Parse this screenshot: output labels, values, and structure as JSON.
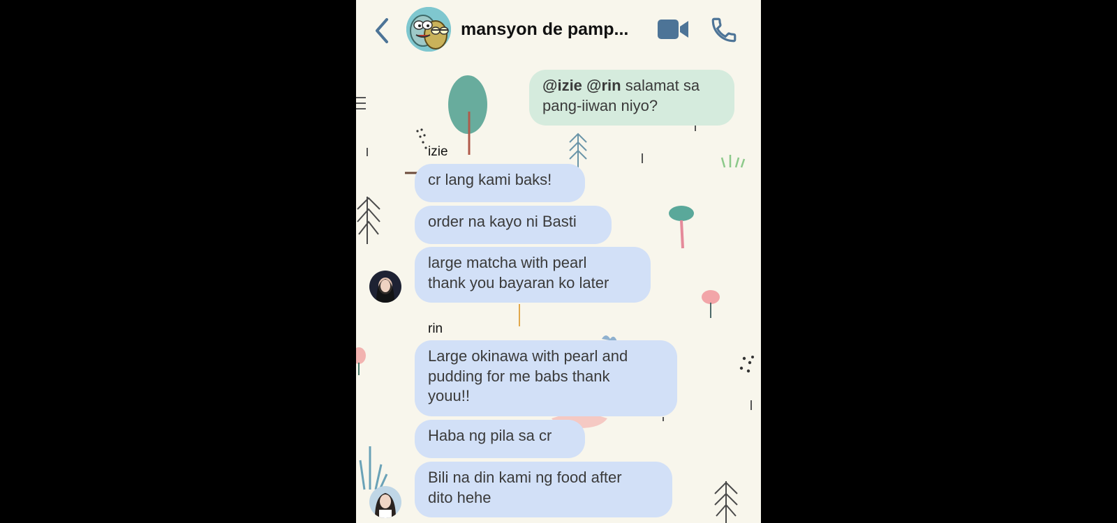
{
  "header": {
    "group_name": "mansyon de pamp...",
    "icons": {
      "back": "chevron-left-icon",
      "video": "video-camera-icon",
      "call": "phone-icon"
    },
    "accent_color": "#4d7497"
  },
  "messages": {
    "outgoing": {
      "mention_1": "@izie",
      "mention_2": "@rin",
      "text_1": " salamat sa",
      "text_2": "pang-iiwan niyo?"
    },
    "izie": {
      "sender": "izie",
      "m1": "cr lang kami baks!",
      "m2": "order na kayo ni Basti",
      "m3_l1": "large matcha with pearl",
      "m3_l2": "thank you bayaran ko later"
    },
    "rin": {
      "sender": "rin",
      "m1_l1": "Large okinawa with pearl and",
      "m1_l2": "pudding for me babs thank",
      "m1_l3": "youu!!",
      "m2": "Haba ng pila sa cr",
      "m3_l1": "Bili na din kami ng food after",
      "m3_l2": "dito hehe"
    }
  },
  "colors": {
    "background": "#f8f6ec",
    "incoming_bubble": "#d2e0f7",
    "outgoing_bubble": "#d5ebdd"
  }
}
